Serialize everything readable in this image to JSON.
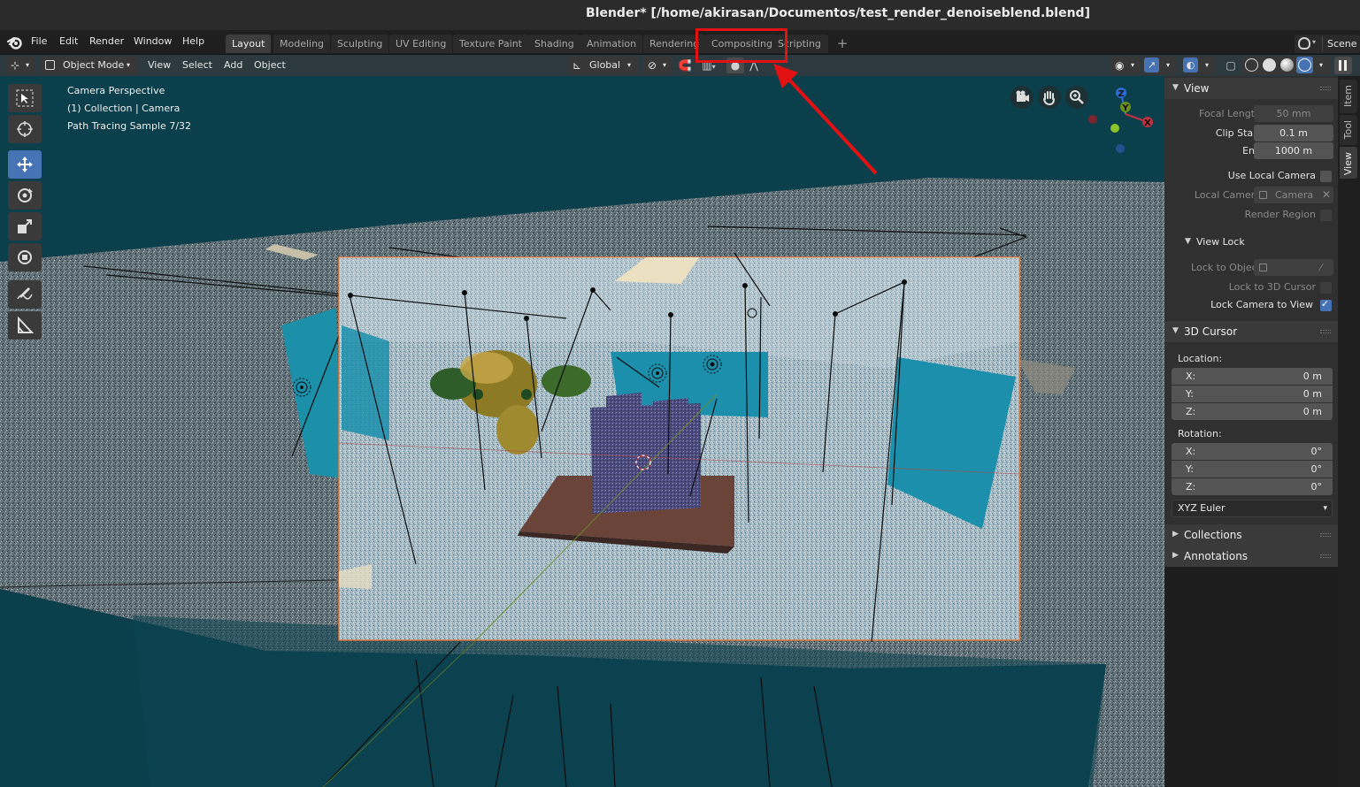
{
  "window": {
    "title": "Blender* [/home/akirasan/Documentos/test_render_denoiseblend.blend]"
  },
  "menu": {
    "file": "File",
    "edit": "Edit",
    "render": "Render",
    "window": "Window",
    "help": "Help"
  },
  "workspaces": [
    {
      "label": "Layout",
      "active": true
    },
    {
      "label": "Modeling"
    },
    {
      "label": "Sculpting"
    },
    {
      "label": "UV Editing"
    },
    {
      "label": "Texture Paint"
    },
    {
      "label": "Shading"
    },
    {
      "label": "Animation"
    },
    {
      "label": "Rendering"
    },
    {
      "label": "Compositing"
    },
    {
      "label": "Scripting"
    }
  ],
  "scene": {
    "label": "Scene"
  },
  "viewport_header": {
    "mode": "Object Mode",
    "view": "View",
    "select": "Select",
    "add": "Add",
    "object": "Object",
    "orientation": "Global"
  },
  "overlay": {
    "line1": "Camera Perspective",
    "line2": "(1) Collection | Camera",
    "line3": "Path Tracing Sample 7/32"
  },
  "gizmo": {
    "z": "Z",
    "y": "Y",
    "x": "X"
  },
  "side_tabs": {
    "item": "Item",
    "tool": "Tool",
    "view": "View"
  },
  "view_panel": {
    "title": "View",
    "focal_length_label": "Focal Length",
    "focal_length": "50 mm",
    "clip_start_label": "Clip Start",
    "clip_start": "0.1 m",
    "end_label": "End",
    "end": "1000 m",
    "use_local_camera": "Use Local Camera",
    "local_camera_label": "Local Camera",
    "local_camera": "Camera",
    "render_region": "Render Region",
    "view_lock_title": "View Lock",
    "lock_to_object": "Lock to Object",
    "lock_to_cursor": "Lock to 3D Cursor",
    "lock_camera": "Lock Camera to View"
  },
  "cursor_panel": {
    "title": "3D Cursor",
    "location_label": "Location:",
    "loc": [
      {
        "k": "X:",
        "v": "0 m"
      },
      {
        "k": "Y:",
        "v": "0 m"
      },
      {
        "k": "Z:",
        "v": "0 m"
      }
    ],
    "rotation_label": "Rotation:",
    "rot": [
      {
        "k": "X:",
        "v": "0°"
      },
      {
        "k": "Y:",
        "v": "0°"
      },
      {
        "k": "Z:",
        "v": "0°"
      }
    ],
    "rotation_mode": "XYZ Euler"
  },
  "collapsed_panels": {
    "collections": "Collections",
    "annotations": "Annotations"
  },
  "colors": {
    "accent": "#4772b3",
    "viewport": "#0b3f4c",
    "highlight": "#e21212"
  }
}
